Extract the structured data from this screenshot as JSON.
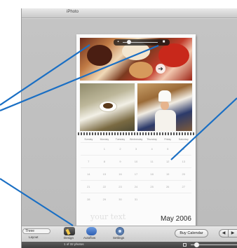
{
  "window": {
    "title": "iPhoto"
  },
  "photo_slider": {
    "left_icon": "photo-small-icon",
    "right_icon": "photo-large-icon",
    "level": 0.12
  },
  "nav_arrow": {
    "icon": "next-arrow-icon",
    "glyph": "➜"
  },
  "calendar": {
    "day_names": [
      "Sunday",
      "Monday",
      "Tuesday",
      "Wednesday",
      "Thursday",
      "Friday",
      "Saturday"
    ],
    "weeks": [
      [
        "",
        "1",
        "2",
        "3",
        "4",
        "5",
        "6"
      ],
      [
        "7",
        "8",
        "9",
        "10",
        "11",
        "12",
        "13"
      ],
      [
        "14",
        "15",
        "16",
        "17",
        "18",
        "19",
        "20"
      ],
      [
        "21",
        "22",
        "23",
        "24",
        "25",
        "26",
        "27"
      ],
      [
        "28",
        "29",
        "30",
        "31",
        "",
        "",
        ""
      ]
    ],
    "watermark": "your text",
    "month_title": "May 2006"
  },
  "toolbar": {
    "layout_select_value": "Three",
    "layout_label": "Layout",
    "design_label": "Design",
    "autoflow_label": "Autoflow",
    "settings_label": "Settings",
    "buy_label": "Buy Calendar",
    "prev_glyph": "◀",
    "next_glyph": "▶"
  },
  "statusbar": {
    "photo_count": "1 of 32 photos"
  },
  "colors": {
    "callout": "#1a6fc4"
  }
}
